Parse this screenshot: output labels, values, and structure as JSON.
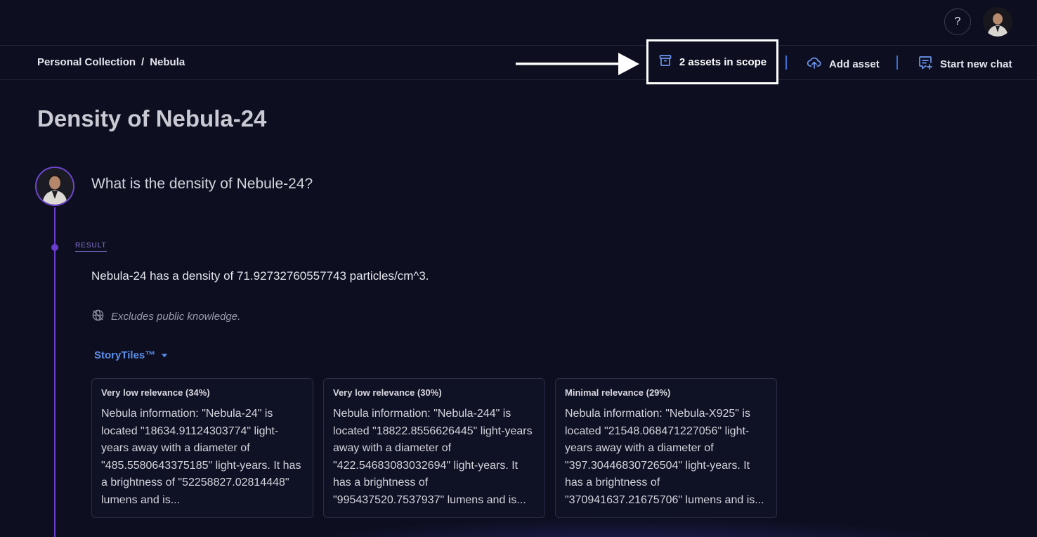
{
  "header": {
    "help_label": "?"
  },
  "breadcrumb": {
    "root": "Personal Collection",
    "separator": "/",
    "current": "Nebula"
  },
  "toolbar": {
    "scope_label": "2 assets in scope",
    "add_asset_label": "Add asset",
    "new_chat_label": "Start new chat"
  },
  "page": {
    "title": "Density of Nebula-24"
  },
  "chat": {
    "question": "What is the density of Nebule-24?",
    "result_tag": "RESULT",
    "answer": "Nebula-24 has a density of 71.92732760557743 particles/cm^3.",
    "note": "Excludes public knowledge.",
    "storytiles_label": "StoryTiles™"
  },
  "tiles": [
    {
      "relevance": "Very low relevance (34%)",
      "text": "Nebula information: \"Nebula-24\" is located \"18634.91124303774\" light-years away with a diameter of \"485.5580643375185\" light-years. It has a brightness of \"52258827.02814448\" lumens and is..."
    },
    {
      "relevance": "Very low relevance (30%)",
      "text": "Nebula information: \"Nebula-244\" is located \"18822.8556626445\" light-years away with a diameter of \"422.54683083032694\" light-years. It has a brightness of \"995437520.7537937\" lumens and is..."
    },
    {
      "relevance": "Minimal relevance (29%)",
      "text": "Nebula information: \"Nebula-X925\" is located \"21548.068471227056\" light-years away with a diameter of \"397.30446830726504\" light-years. It has a brightness of \"370941637.21675706\" lumens and is..."
    }
  ],
  "colors": {
    "background": "#0d0f21",
    "accent_purple": "#6a3dcf",
    "accent_blue": "#5b8ee8",
    "highlight_border": "#ffffff"
  },
  "icons": {
    "scope": "archive-box-icon",
    "add_asset": "cloud-upload-icon",
    "new_chat": "chat-plus-icon",
    "note": "globe-off-icon",
    "storytiles": "caret-down-icon"
  }
}
